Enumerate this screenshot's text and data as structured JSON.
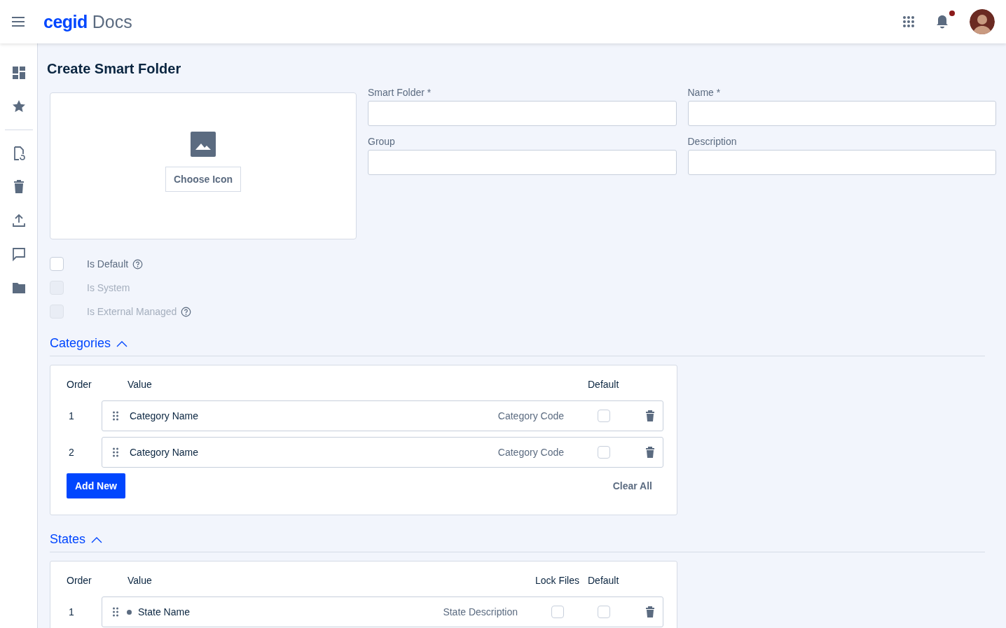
{
  "header": {
    "brand": "cegid",
    "product": "Docs",
    "notification_dot": true
  },
  "page_title": "Create Smart Folder",
  "icon_picker": {
    "button": "Choose Icon"
  },
  "fields": [
    {
      "label": "Smart Folder *"
    },
    {
      "label": "Name *"
    },
    {
      "label": "Group"
    },
    {
      "label": "Description"
    }
  ],
  "options": [
    {
      "label": "Is Default",
      "checked": false,
      "disabled": false,
      "help": true
    },
    {
      "label": "Is System",
      "checked": false,
      "disabled": true,
      "help": false
    },
    {
      "label": "Is External Managed",
      "checked": false,
      "disabled": true,
      "help": true
    }
  ],
  "categories": {
    "title": "Categories",
    "expanded": true,
    "columns": [
      "Order",
      "Value",
      "Default"
    ],
    "rows": [
      {
        "order": "1",
        "name": "Category Name",
        "code": "Category Code",
        "default": false
      },
      {
        "order": "2",
        "name": "Category Name",
        "code": "Category Code",
        "default": false
      }
    ],
    "add_button": "Add New",
    "clear_button": "Clear All"
  },
  "states": {
    "title": "States",
    "expanded": true,
    "columns": [
      "Order",
      "Value",
      "Lock Files",
      "Default"
    ],
    "rows": [
      {
        "order": "1",
        "name": "State Name",
        "description": "State Description",
        "lock_files": false,
        "default": false,
        "color": "#5b6b80"
      }
    ]
  }
}
